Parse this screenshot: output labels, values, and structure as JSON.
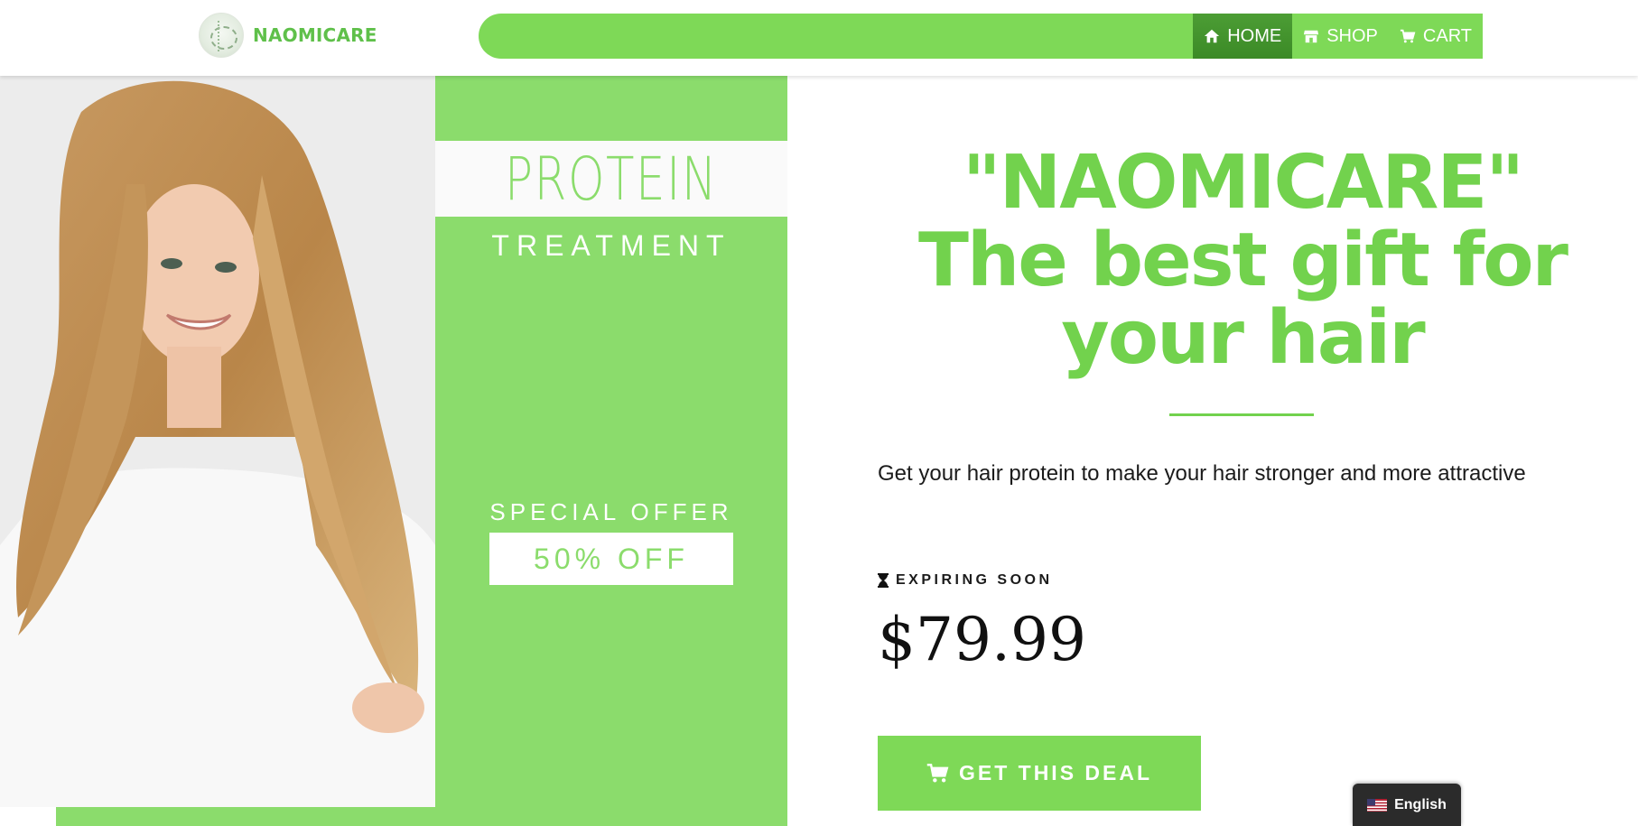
{
  "header": {
    "brand": "NAOMICARE",
    "nav": [
      {
        "label": "HOME",
        "icon": "home-icon",
        "active": true
      },
      {
        "label": "SHOP",
        "icon": "store-icon",
        "active": false
      },
      {
        "label": "CART",
        "icon": "cart-icon",
        "active": false
      }
    ]
  },
  "banner": {
    "title": "PROTEIN",
    "subtitle": "TREATMENT",
    "offer_label": "SPECIAL OFFER",
    "offer_value": "50% OFF"
  },
  "main": {
    "headline": "\"NAOMICARE\" The best gift for your hair",
    "description": "Get your hair protein to make your hair stronger and more attractive",
    "expiring_label": "EXPIRING SOON",
    "price": "$79.99",
    "cta_label": "GET THIS DEAL"
  },
  "language": {
    "label": "English"
  },
  "colors": {
    "brand_green": "#7ed957",
    "active_nav": "#3f8f2a",
    "banner_green": "#8bdc6c"
  }
}
